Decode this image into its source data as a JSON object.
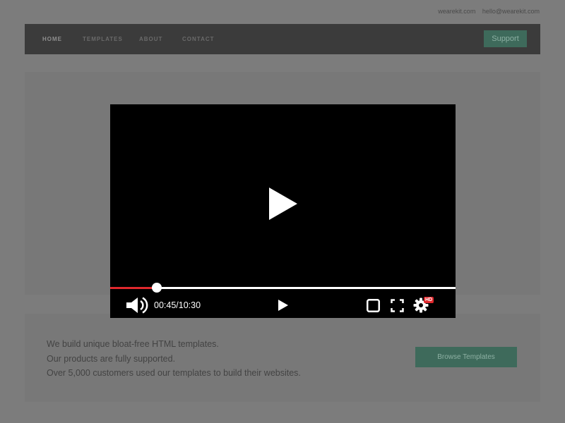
{
  "topbar": {
    "site": "wearekit.com",
    "email": "hello@wearekit.com"
  },
  "nav": {
    "items": [
      {
        "label": "HOME",
        "active": true
      },
      {
        "label": "TEMPLATES",
        "active": false
      },
      {
        "label": "ABOUT",
        "active": false
      },
      {
        "label": "CONTACT",
        "active": false
      }
    ],
    "support_label": "Support"
  },
  "info": {
    "lines": [
      "We build unique bloat-free HTML templates.",
      "Our products are fully supported.",
      "Over 5,000 customers used our templates to build their websites."
    ],
    "browse_label": "Browse Templates"
  },
  "player": {
    "time_display": "00:45/10:30",
    "progress_fraction": 0.135,
    "quality_badge": "HD",
    "icons": [
      "play-icon",
      "volume-icon",
      "miniplayer-icon",
      "fullscreen-icon",
      "settings-icon"
    ]
  },
  "colors": {
    "accent": "#3e6a5b",
    "progress_red": "#e0282d",
    "nav_bg": "#3b3b3b"
  }
}
